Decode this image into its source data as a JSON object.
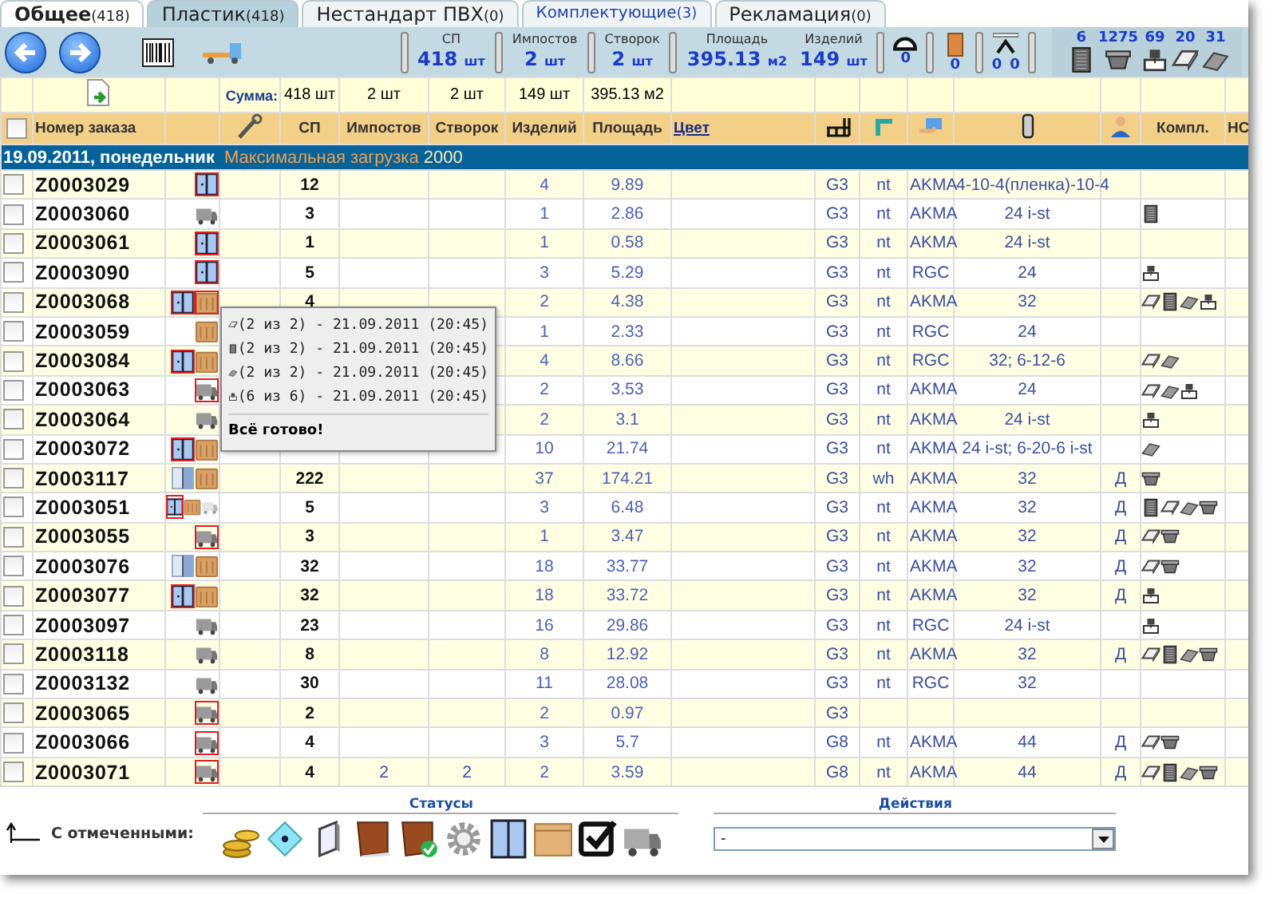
{
  "tabs": [
    {
      "label": "Общее",
      "count": "(418)",
      "selected": false,
      "emphasized": true
    },
    {
      "label": "Пластик",
      "count": "(418)",
      "selected": true,
      "emphasized": false
    },
    {
      "label": "Нестандарт ПВХ",
      "count": "(0)",
      "selected": false,
      "emphasized": false
    },
    {
      "label": "Комплектующие",
      "count": "(3)",
      "selected": false,
      "emphasized": false
    },
    {
      "label": "Рекламация",
      "count": "(0)",
      "selected": false,
      "emphasized": false
    }
  ],
  "toolbar": {
    "stat_groups": [
      [
        {
          "label": "СП",
          "value": "418",
          "unit": "шт"
        }
      ],
      [
        {
          "label": "Импостов",
          "value": "2",
          "unit": "шт"
        }
      ],
      [
        {
          "label": "Створок",
          "value": "2",
          "unit": "шт"
        }
      ],
      [
        {
          "label": "Площадь",
          "value": "395.13",
          "unit": "м2"
        },
        {
          "label": "Изделий",
          "value": "149",
          "unit": "шт"
        }
      ]
    ],
    "gauges": [
      {
        "kind": "arc",
        "values": [
          "0"
        ]
      },
      {
        "kind": "door",
        "values": [
          "0"
        ]
      },
      {
        "kind": "stand",
        "values": [
          "0",
          "0"
        ]
      }
    ],
    "counters": [
      {
        "kind": "mesh",
        "count": "6"
      },
      {
        "kind": "pot",
        "count": "1275"
      },
      {
        "kind": "press",
        "count": "69"
      },
      {
        "kind": "glass",
        "count": "20"
      },
      {
        "kind": "profile",
        "count": "31"
      }
    ]
  },
  "sum_row": {
    "label": "Сумма:",
    "values": [
      "418 шт",
      "2 шт",
      "2 шт",
      "149 шт",
      "395.13 м2"
    ]
  },
  "header": {
    "checked": false,
    "columns": [
      "Номер заказа",
      "СП",
      "Импостов",
      "Створок",
      "Изделий",
      "Площадь"
    ],
    "color_link": "Цвет",
    "kompl": "Компл.",
    "cut": "НС"
  },
  "group": {
    "date": "19.09.2011, понедельник",
    "load_label": "Максимальная загрузка",
    "load_value": "2000"
  },
  "rows": [
    {
      "checked": false,
      "order": "Z0003029",
      "status": [
        {
          "kind": "window",
          "flagged": true
        }
      ],
      "sp": "12",
      "izd": "4",
      "area": "9.89",
      "c1": "G3",
      "c2": "nt",
      "c3": "AKMA",
      "glass": "4-10-4(пленка)-10-4",
      "kompl": []
    },
    {
      "checked": false,
      "order": "Z0003060",
      "status": [
        {
          "kind": "truck",
          "flagged": false
        }
      ],
      "sp": "3",
      "izd": "1",
      "area": "2.86",
      "c1": "G3",
      "c2": "nt",
      "c3": "AKMA",
      "glass": "24 i-st",
      "kompl": [
        {
          "kind": "mesh"
        }
      ]
    },
    {
      "checked": false,
      "order": "Z0003061",
      "status": [
        {
          "kind": "window",
          "flagged": true
        }
      ],
      "sp": "1",
      "izd": "1",
      "area": "0.58",
      "c1": "G3",
      "c2": "nt",
      "c3": "AKMA",
      "glass": "24 i-st",
      "kompl": []
    },
    {
      "checked": false,
      "order": "Z0003090",
      "status": [
        {
          "kind": "window",
          "flagged": true
        }
      ],
      "sp": "5",
      "izd": "3",
      "area": "5.29",
      "c1": "G3",
      "c2": "nt",
      "c3": "RGC",
      "glass": "24",
      "kompl": [
        {
          "kind": "press"
        }
      ]
    },
    {
      "checked": false,
      "order": "Z0003068",
      "status": [
        {
          "kind": "window",
          "flagged": true
        },
        {
          "kind": "crate",
          "flagged": true
        }
      ],
      "sp": "4",
      "izd": "2",
      "area": "4.38",
      "c1": "G3",
      "c2": "nt",
      "c3": "AKMA",
      "glass": "32",
      "kompl": [
        {
          "kind": "glass"
        },
        {
          "kind": "mesh"
        },
        {
          "kind": "profile"
        },
        {
          "kind": "press"
        }
      ]
    },
    {
      "checked": false,
      "order": "Z0003059",
      "status": [
        {
          "kind": "crate",
          "flagged": false
        }
      ],
      "izd": "1",
      "area": "2.33",
      "c1": "G3",
      "c2": "nt",
      "c3": "RGC",
      "glass": "24",
      "kompl": []
    },
    {
      "checked": false,
      "order": "Z0003084",
      "status": [
        {
          "kind": "window",
          "flagged": true
        },
        {
          "kind": "crate",
          "flagged": false
        }
      ],
      "izd": "4",
      "area": "8.66",
      "c1": "G3",
      "c2": "nt",
      "c3": "RGC",
      "glass": "32; 6-12-6",
      "kompl": [
        {
          "kind": "glass"
        },
        {
          "kind": "profile"
        }
      ]
    },
    {
      "checked": false,
      "order": "Z0003063",
      "status": [
        {
          "kind": "truck",
          "flagged": true
        }
      ],
      "izd": "2",
      "area": "3.53",
      "c1": "G3",
      "c2": "nt",
      "c3": "AKMA",
      "glass": "24",
      "kompl": [
        {
          "kind": "glass"
        },
        {
          "kind": "profile"
        },
        {
          "kind": "press"
        }
      ]
    },
    {
      "checked": false,
      "order": "Z0003064",
      "status": [
        {
          "kind": "truck",
          "flagged": false
        }
      ],
      "izd": "2",
      "area": "3.1",
      "c1": "G3",
      "c2": "nt",
      "c3": "AKMA",
      "glass": "24 i-st",
      "kompl": [
        {
          "kind": "press"
        }
      ]
    },
    {
      "checked": false,
      "order": "Z0003072",
      "status": [
        {
          "kind": "window",
          "flagged": true
        },
        {
          "kind": "crate",
          "flagged": false
        }
      ],
      "izd": "10",
      "area": "21.74",
      "c1": "G3",
      "c2": "nt",
      "c3": "AKMA",
      "glass": "24 i-st; 6-20-6 i-st",
      "kompl": [
        {
          "kind": "profile"
        }
      ]
    },
    {
      "checked": false,
      "order": "Z0003117",
      "status": [
        {
          "kind": "window-pale",
          "flagged": false
        },
        {
          "kind": "crate",
          "flagged": false
        }
      ],
      "sp": "222",
      "izd": "37",
      "area": "174.21",
      "c1": "G3",
      "c2": "wh",
      "c3": "AKMA",
      "glass": "32",
      "d": "Д",
      "kompl": [
        {
          "kind": "pot"
        }
      ]
    },
    {
      "checked": false,
      "order": "Z0003051",
      "status": [
        {
          "kind": "window",
          "flagged": true
        },
        {
          "kind": "crate",
          "flagged": false
        },
        {
          "kind": "truck-pale",
          "flagged": false
        }
      ],
      "sp": "5",
      "izd": "3",
      "area": "6.48",
      "c1": "G3",
      "c2": "nt",
      "c3": "AKMA",
      "glass": "32",
      "d": "Д",
      "kompl": [
        {
          "kind": "mesh"
        },
        {
          "kind": "glass"
        },
        {
          "kind": "profile"
        },
        {
          "kind": "pot"
        }
      ]
    },
    {
      "checked": false,
      "order": "Z0003055",
      "status": [
        {
          "kind": "truck",
          "flagged": true
        }
      ],
      "sp": "3",
      "izd": "1",
      "area": "3.47",
      "c1": "G3",
      "c2": "nt",
      "c3": "AKMA",
      "glass": "32",
      "d": "Д",
      "kompl": [
        {
          "kind": "glass"
        },
        {
          "kind": "pot"
        }
      ]
    },
    {
      "checked": false,
      "order": "Z0003076",
      "status": [
        {
          "kind": "window-pale",
          "flagged": false
        },
        {
          "kind": "crate",
          "flagged": false
        }
      ],
      "sp": "32",
      "izd": "18",
      "area": "33.77",
      "c1": "G3",
      "c2": "nt",
      "c3": "AKMA",
      "glass": "32",
      "d": "Д",
      "kompl": [
        {
          "kind": "glass"
        },
        {
          "kind": "pot"
        }
      ]
    },
    {
      "checked": false,
      "order": "Z0003077",
      "status": [
        {
          "kind": "window",
          "flagged": true
        },
        {
          "kind": "crate",
          "flagged": false
        }
      ],
      "sp": "32",
      "izd": "18",
      "area": "33.72",
      "c1": "G3",
      "c2": "nt",
      "c3": "AKMA",
      "glass": "32",
      "d": "Д",
      "kompl": [
        {
          "kind": "press"
        }
      ]
    },
    {
      "checked": false,
      "order": "Z0003097",
      "status": [
        {
          "kind": "truck",
          "flagged": false
        }
      ],
      "sp": "23",
      "izd": "16",
      "area": "29.86",
      "c1": "G3",
      "c2": "nt",
      "c3": "RGC",
      "glass": "24 i-st",
      "kompl": [
        {
          "kind": "press"
        }
      ]
    },
    {
      "checked": false,
      "order": "Z0003118",
      "status": [
        {
          "kind": "truck",
          "flagged": false
        }
      ],
      "sp": "8",
      "izd": "8",
      "area": "12.92",
      "c1": "G3",
      "c2": "nt",
      "c3": "AKMA",
      "glass": "32",
      "d": "Д",
      "kompl": [
        {
          "kind": "glass"
        },
        {
          "kind": "mesh"
        },
        {
          "kind": "profile"
        },
        {
          "kind": "pot"
        }
      ]
    },
    {
      "checked": false,
      "order": "Z0003132",
      "status": [
        {
          "kind": "truck",
          "flagged": false
        }
      ],
      "sp": "30",
      "izd": "11",
      "area": "28.08",
      "c1": "G3",
      "c2": "nt",
      "c3": "RGC",
      "glass": "32",
      "kompl": []
    },
    {
      "checked": false,
      "order": "Z0003065",
      "status": [
        {
          "kind": "truck",
          "flagged": true
        }
      ],
      "sp": "2",
      "izd": "2",
      "area": "0.97",
      "c1": "G3",
      "kompl": []
    },
    {
      "checked": false,
      "order": "Z0003066",
      "status": [
        {
          "kind": "truck",
          "flagged": true
        }
      ],
      "sp": "4",
      "izd": "3",
      "area": "5.7",
      "c1": "G8",
      "c2": "nt",
      "c3": "AKMA",
      "glass": "44",
      "d": "Д",
      "kompl": [
        {
          "kind": "glass"
        },
        {
          "kind": "pot"
        }
      ]
    },
    {
      "checked": false,
      "order": "Z0003071",
      "status": [
        {
          "kind": "truck",
          "flagged": true
        }
      ],
      "sp": "4",
      "imp": "2",
      "stv": "2",
      "izd": "2",
      "area": "3.59",
      "c1": "G8",
      "c2": "nt",
      "c3": "AKMA",
      "glass": "44",
      "d": "Д",
      "kompl": [
        {
          "kind": "glass"
        },
        {
          "kind": "mesh"
        },
        {
          "kind": "profile"
        },
        {
          "kind": "pot"
        }
      ]
    }
  ],
  "tooltip": {
    "lines": [
      {
        "kind": "glass",
        "text": "(2 из 2) - 21.09.2011 (20:45)"
      },
      {
        "kind": "mesh",
        "text": "(2 из 2) - 21.09.2011 (20:45)"
      },
      {
        "kind": "profile",
        "text": "(2 из 2) - 21.09.2011 (20:45)"
      },
      {
        "kind": "press",
        "text": "(6 из 6) - 21.09.2011 (20:45)"
      }
    ],
    "footer": "Всё готово!"
  },
  "footer": {
    "with_selected": "С отмеченными:",
    "statuses_title": "Статусы",
    "actions_title": "Действия",
    "action_value": "-"
  }
}
